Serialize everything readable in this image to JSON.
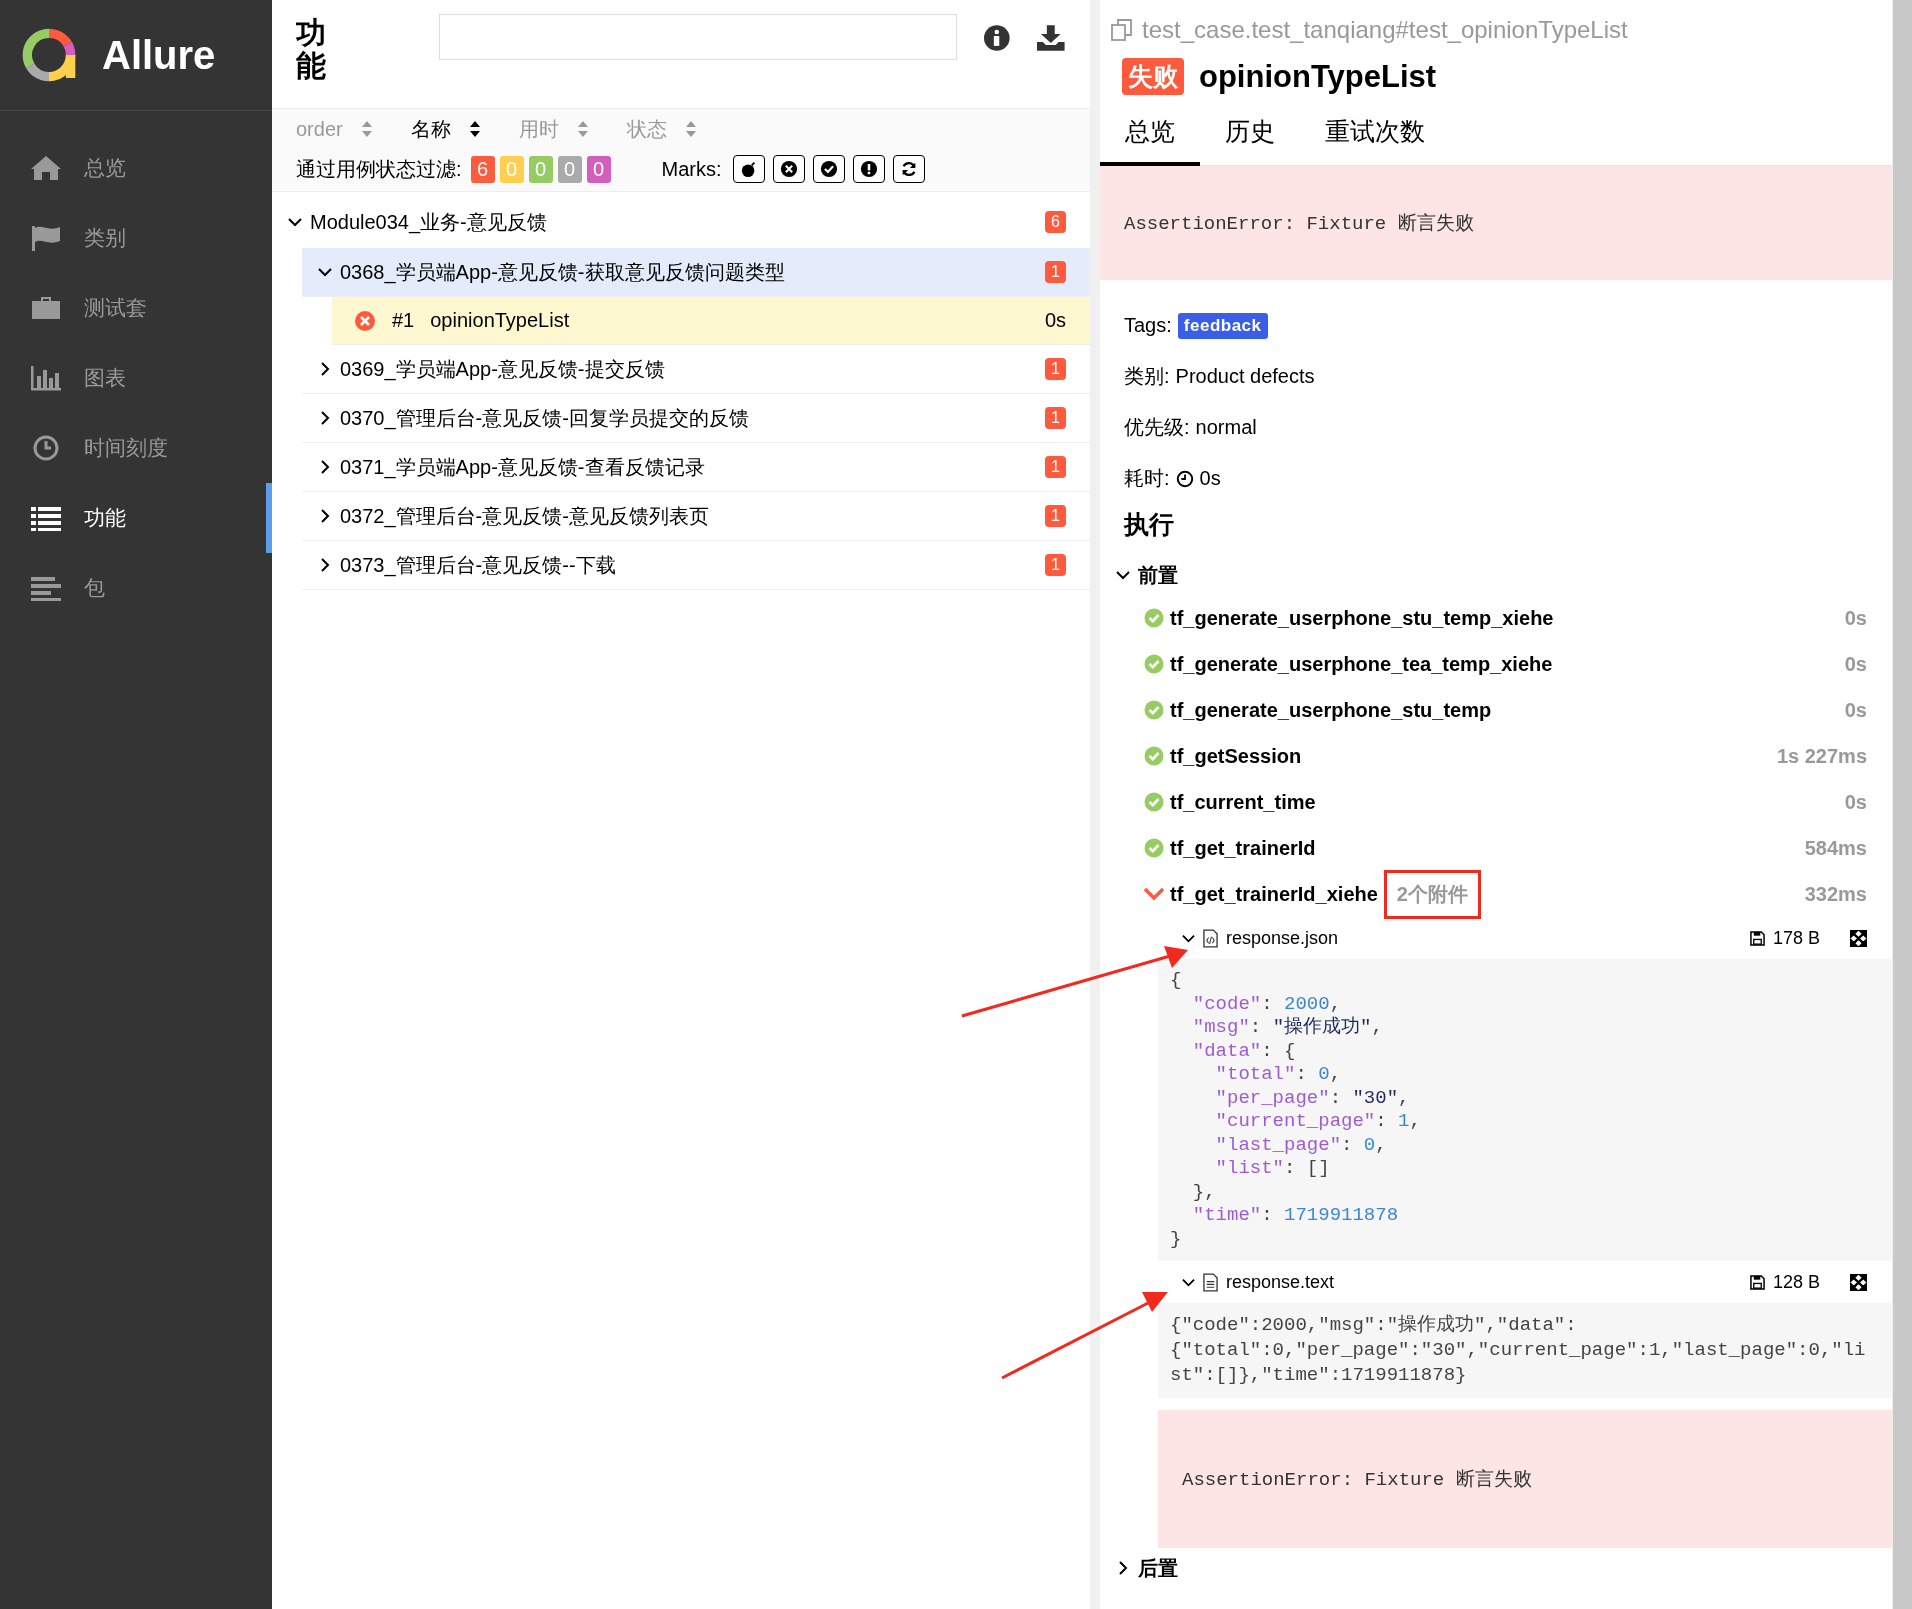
{
  "sidebar": {
    "logo_text": "Allure",
    "items": [
      {
        "label": "总览",
        "selected": false
      },
      {
        "label": "类别",
        "selected": false
      },
      {
        "label": "测试套",
        "selected": false
      },
      {
        "label": "图表",
        "selected": false
      },
      {
        "label": "时间刻度",
        "selected": false
      },
      {
        "label": "功能",
        "selected": true
      },
      {
        "label": "包",
        "selected": false
      }
    ]
  },
  "tree_pane": {
    "title": "功能",
    "sort_columns": [
      {
        "label": "order",
        "selected": false
      },
      {
        "label": "名称",
        "selected": true
      },
      {
        "label": "用时",
        "selected": false
      },
      {
        "label": "状态",
        "selected": false
      }
    ],
    "status_filter": {
      "label": "通过用例状态过滤:",
      "counts": [
        {
          "value": "6",
          "color": "#fd5a3e"
        },
        {
          "value": "0",
          "color": "#ffd050"
        },
        {
          "value": "0",
          "color": "#97cc64"
        },
        {
          "value": "0",
          "color": "#aaaaaa"
        },
        {
          "value": "0",
          "color": "#d35ebe"
        }
      ]
    },
    "marks": {
      "label": "Marks:",
      "items": [
        {
          "kind": "bomb"
        },
        {
          "kind": "cross"
        },
        {
          "kind": "check"
        },
        {
          "kind": "exclamation"
        },
        {
          "kind": "retry"
        }
      ]
    },
    "groups": [
      {
        "name": "Module034_业务-意见反馈",
        "count": "6",
        "expanded": true,
        "children": [
          {
            "name": "0368_学员端App-意见反馈-获取意见反馈问题类型",
            "count": "1",
            "expanded": true,
            "selected": true,
            "children": [
              {
                "index": "#1",
                "name": "opinionTypeList",
                "duration": "0s",
                "color": "#fd5a3e",
                "selected": true
              }
            ]
          },
          {
            "name": "0369_学员端App-意见反馈-提交反馈",
            "count": "1",
            "expanded": false,
            "selected": false
          },
          {
            "name": "0370_管理后台-意见反馈-回复学员提交的反馈",
            "count": "1",
            "expanded": false,
            "selected": false
          },
          {
            "name": "0371_学员端App-意见反馈-查看反馈记录",
            "count": "1",
            "expanded": false,
            "selected": false
          },
          {
            "name": "0372_管理后台-意见反馈-意见反馈列表页",
            "count": "1",
            "expanded": false,
            "selected": false
          },
          {
            "name": "0373_管理后台-意见反馈--下载",
            "count": "1",
            "expanded": false,
            "selected": false
          }
        ]
      }
    ]
  },
  "test_result": {
    "full_name": "test_case.test_tanqiang#test_opinionTypeList",
    "color": "#fd5a3e",
    "status_label": "失败",
    "title": "opinionTypeList",
    "tabs": [
      {
        "label": "总览",
        "selected": true
      },
      {
        "label": "历史",
        "selected": false
      },
      {
        "label": "重试次数",
        "selected": false
      }
    ],
    "error": "AssertionError: Fixture 断言失败",
    "tags_label": "Tags:",
    "tags": [
      "feedback"
    ],
    "fields": [
      {
        "label": "类别:",
        "value": "Product defects",
        "kind": "text"
      },
      {
        "label": "优先级:",
        "value": "normal",
        "kind": "text"
      },
      {
        "label": "耗时:",
        "value": "0s",
        "kind": "duration"
      }
    ],
    "execution_title": "执行",
    "setup": {
      "title": "前置",
      "expanded": true,
      "steps": [
        {
          "name": "tf_generate_userphone_stu_temp_xiehe",
          "duration": "0s",
          "color": "#97cc64",
          "expanded": false
        },
        {
          "name": "tf_generate_userphone_tea_temp_xiehe",
          "duration": "0s",
          "color": "#97cc64",
          "expanded": false
        },
        {
          "name": "tf_generate_userphone_stu_temp",
          "duration": "0s",
          "color": "#97cc64",
          "expanded": false
        },
        {
          "name": "tf_getSession",
          "duration": "1s 227ms",
          "color": "#97cc64",
          "expanded": false
        },
        {
          "name": "tf_current_time",
          "duration": "0s",
          "color": "#97cc64",
          "expanded": false
        },
        {
          "name": "tf_get_trainerId",
          "duration": "584ms",
          "color": "#97cc64",
          "expanded": false
        },
        {
          "name": "tf_get_trainerId_xiehe",
          "duration": "332ms",
          "color": "#fd5a3e",
          "expanded": true,
          "attachments_label": "2个附件",
          "highlighted": true,
          "attachments": [
            {
              "name": "response.json",
              "kind": "json",
              "size": "178 B",
              "expanded": true,
              "lines": [
                "{",
                "  \"code\": 2000,",
                "  \"msg\": \"操作成功\",",
                "  \"data\": {",
                "    \"total\": 0,",
                "    \"per_page\": \"30\",",
                "    \"current_page\": 1,",
                "    \"last_page\": 0,",
                "    \"list\": []",
                "  },",
                "  \"time\": 1719911878",
                "}"
              ]
            },
            {
              "name": "response.text",
              "kind": "text",
              "size": "128 B",
              "expanded": true,
              "content": "{\"code\":2000,\"msg\":\"操作成功\",\"data\":{\"total\":0,\"per_page\":\"30\",\"current_page\":1,\"last_page\":0,\"list\":[]},\"time\":1719911878}"
            }
          ],
          "error": "AssertionError: Fixture 断言失败"
        }
      ]
    },
    "teardown": {
      "title": "后置",
      "expanded": false
    }
  }
}
